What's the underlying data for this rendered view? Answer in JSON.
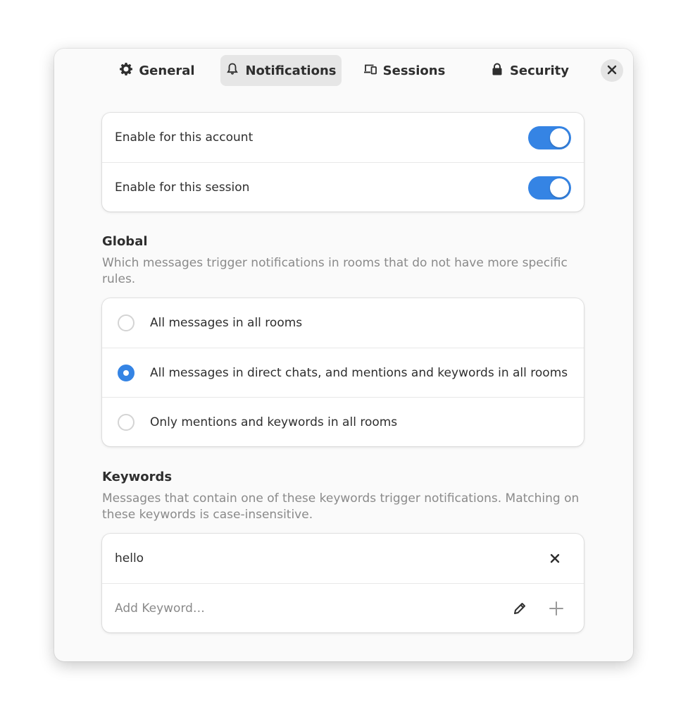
{
  "tabs": [
    {
      "label": "General",
      "icon": "gear-icon"
    },
    {
      "label": "Notifications",
      "icon": "bell-icon",
      "active": true
    },
    {
      "label": "Sessions",
      "icon": "devices-icon"
    },
    {
      "label": "Security",
      "icon": "lock-icon"
    }
  ],
  "toggles": [
    {
      "label": "Enable for this account",
      "on": true
    },
    {
      "label": "Enable for this session",
      "on": true
    }
  ],
  "global": {
    "title": "Global",
    "description": "Which messages trigger notifications in rooms that do not have more specific rules.",
    "options": [
      {
        "label": "All messages in all rooms",
        "selected": false
      },
      {
        "label": "All messages in direct chats, and mentions and keywords in all rooms",
        "selected": true
      },
      {
        "label": "Only mentions and keywords in all rooms",
        "selected": false
      }
    ]
  },
  "keywords": {
    "title": "Keywords",
    "description": "Messages that contain one of these keywords trigger notifications. Matching on these keywords is case-insensitive.",
    "items": [
      "hello"
    ],
    "add_placeholder": "Add Keyword…"
  },
  "colors": {
    "accent": "#3584e4",
    "window_bg": "#fafafa",
    "card_bg": "#ffffff",
    "dim_text": "#8a8a8a"
  }
}
